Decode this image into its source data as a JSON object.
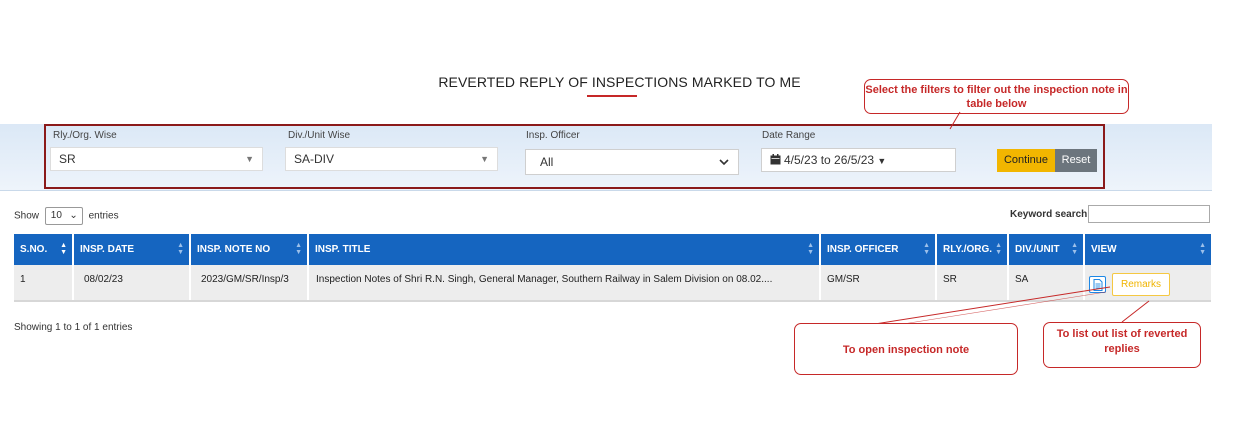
{
  "page": {
    "title": "REVERTED REPLY OF INSPECTIONS MARKED TO ME"
  },
  "filters": {
    "rly_org": {
      "label": "Rly./Org. Wise",
      "value": "SR"
    },
    "div_unit": {
      "label": "Div./Unit Wise",
      "value": "SA-DIV"
    },
    "insp_officer": {
      "label": "Insp. Officer",
      "value": "All"
    },
    "date_range": {
      "label": "Date Range",
      "value": "4/5/23 to 26/5/23"
    },
    "continue_label": "Continue",
    "reset_label": "Reset"
  },
  "table_controls": {
    "show_label": "Show",
    "entries_value": "10",
    "entries_label": "entries",
    "keyword_label": "Keyword search:"
  },
  "table": {
    "headers": [
      "S.NO.",
      "INSP. DATE",
      "INSP. NOTE NO",
      "INSP. TITLE",
      "INSP. OFFICER",
      "RLY./ORG.",
      "DIV./UNIT",
      "VIEW"
    ],
    "rows": [
      {
        "sno": "1",
        "date": "08/02/23",
        "note_no": "2023/GM/SR/Insp/3",
        "title": "Inspection Notes of Shri R.N. Singh, General Manager, Southern Railway in Salem Division on 08.02....",
        "officer": "GM/SR",
        "rly": "SR",
        "div": "SA",
        "remarks_label": "Remarks"
      }
    ],
    "footer": "Showing 1 to 1 of 1 entries"
  },
  "callouts": {
    "filter_note": "Select the filters to filter out the inspection note in table below",
    "open_note": "To open inspection note",
    "list_replies": "To list out list of reverted replies"
  },
  "colors": {
    "header_blue": "#1565c0",
    "accent_red": "#c62828",
    "continue_yellow": "#f2b600",
    "reset_gray": "#6c757d"
  }
}
